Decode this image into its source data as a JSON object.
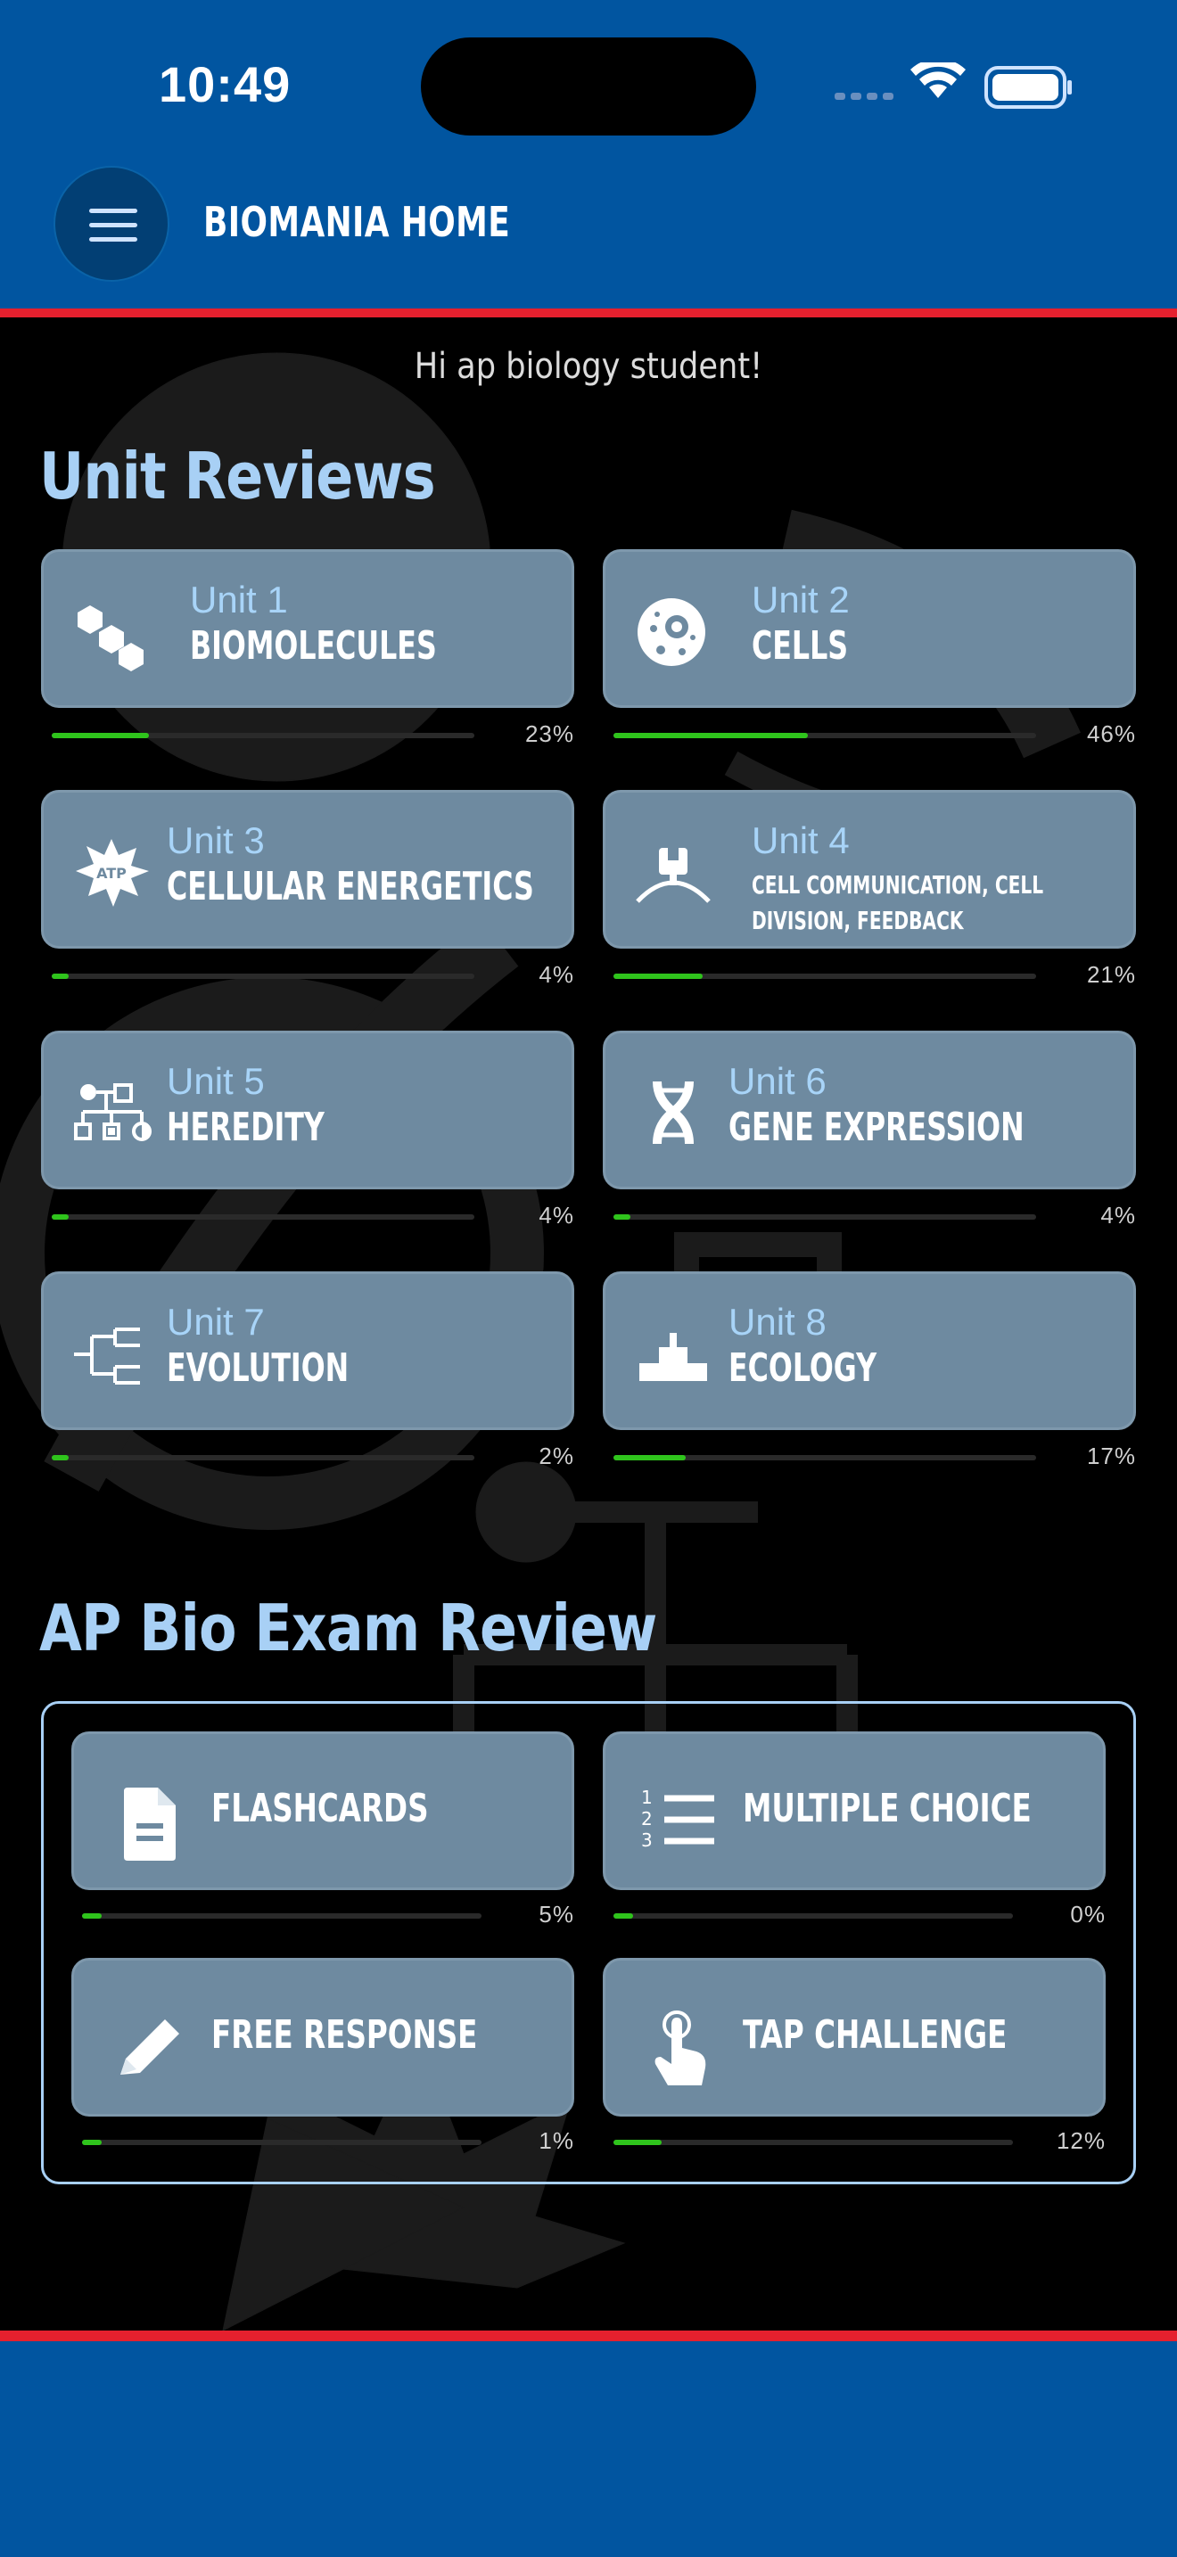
{
  "status_bar": {
    "time": "10:49"
  },
  "header": {
    "title": "BIOMANIA HOME",
    "menu_icon": "hamburger-menu-icon"
  },
  "greeting": "Hi ap biology student!",
  "unit_reviews": {
    "title": "Unit Reviews",
    "units": [
      {
        "number": "Unit 1",
        "name": "BIOMOLECULES",
        "progress": 23,
        "progress_label": "23%",
        "icon": "biomolecules-icon"
      },
      {
        "number": "Unit 2",
        "name": "CELLS",
        "progress": 46,
        "progress_label": "46%",
        "icon": "cell-icon"
      },
      {
        "number": "Unit 3",
        "name": "CELLULAR ENERGETICS",
        "progress": 4,
        "progress_label": "4%",
        "icon": "atp-icon",
        "icon_text": "ATP"
      },
      {
        "number": "Unit 4",
        "name": "CELL COMMUNICATION, CELL DIVISION, FEEDBACK",
        "progress": 21,
        "progress_label": "21%",
        "icon": "receptor-icon"
      },
      {
        "number": "Unit 5",
        "name": "HEREDITY",
        "progress": 4,
        "progress_label": "4%",
        "icon": "pedigree-icon"
      },
      {
        "number": "Unit 6",
        "name": "GENE EXPRESSION",
        "progress": 4,
        "progress_label": "4%",
        "icon": "dna-icon"
      },
      {
        "number": "Unit 7",
        "name": "EVOLUTION",
        "progress": 2,
        "progress_label": "2%",
        "icon": "phylogeny-tree-icon"
      },
      {
        "number": "Unit 8",
        "name": "ECOLOGY",
        "progress": 17,
        "progress_label": "17%",
        "icon": "ecology-pyramid-icon"
      }
    ]
  },
  "exam_review": {
    "title": "AP Bio Exam Review",
    "items": [
      {
        "label": "FLASHCARDS",
        "progress": 5,
        "progress_label": "5%",
        "icon": "document-icon"
      },
      {
        "label": "MULTIPLE CHOICE",
        "progress": 0,
        "progress_label": "0%",
        "icon": "numbered-list-icon"
      },
      {
        "label": "FREE RESPONSE",
        "progress": 1,
        "progress_label": "1%",
        "icon": "pencil-icon"
      },
      {
        "label": "TAP CHALLENGE",
        "progress": 12,
        "progress_label": "12%",
        "icon": "tap-finger-icon"
      }
    ]
  },
  "colors": {
    "header_blue": "#0155a0",
    "accent_red": "#e5202e",
    "card_gray": "#6e8aa0",
    "title_blue": "#a8d0f5",
    "progress_green": "#2fc41c"
  }
}
